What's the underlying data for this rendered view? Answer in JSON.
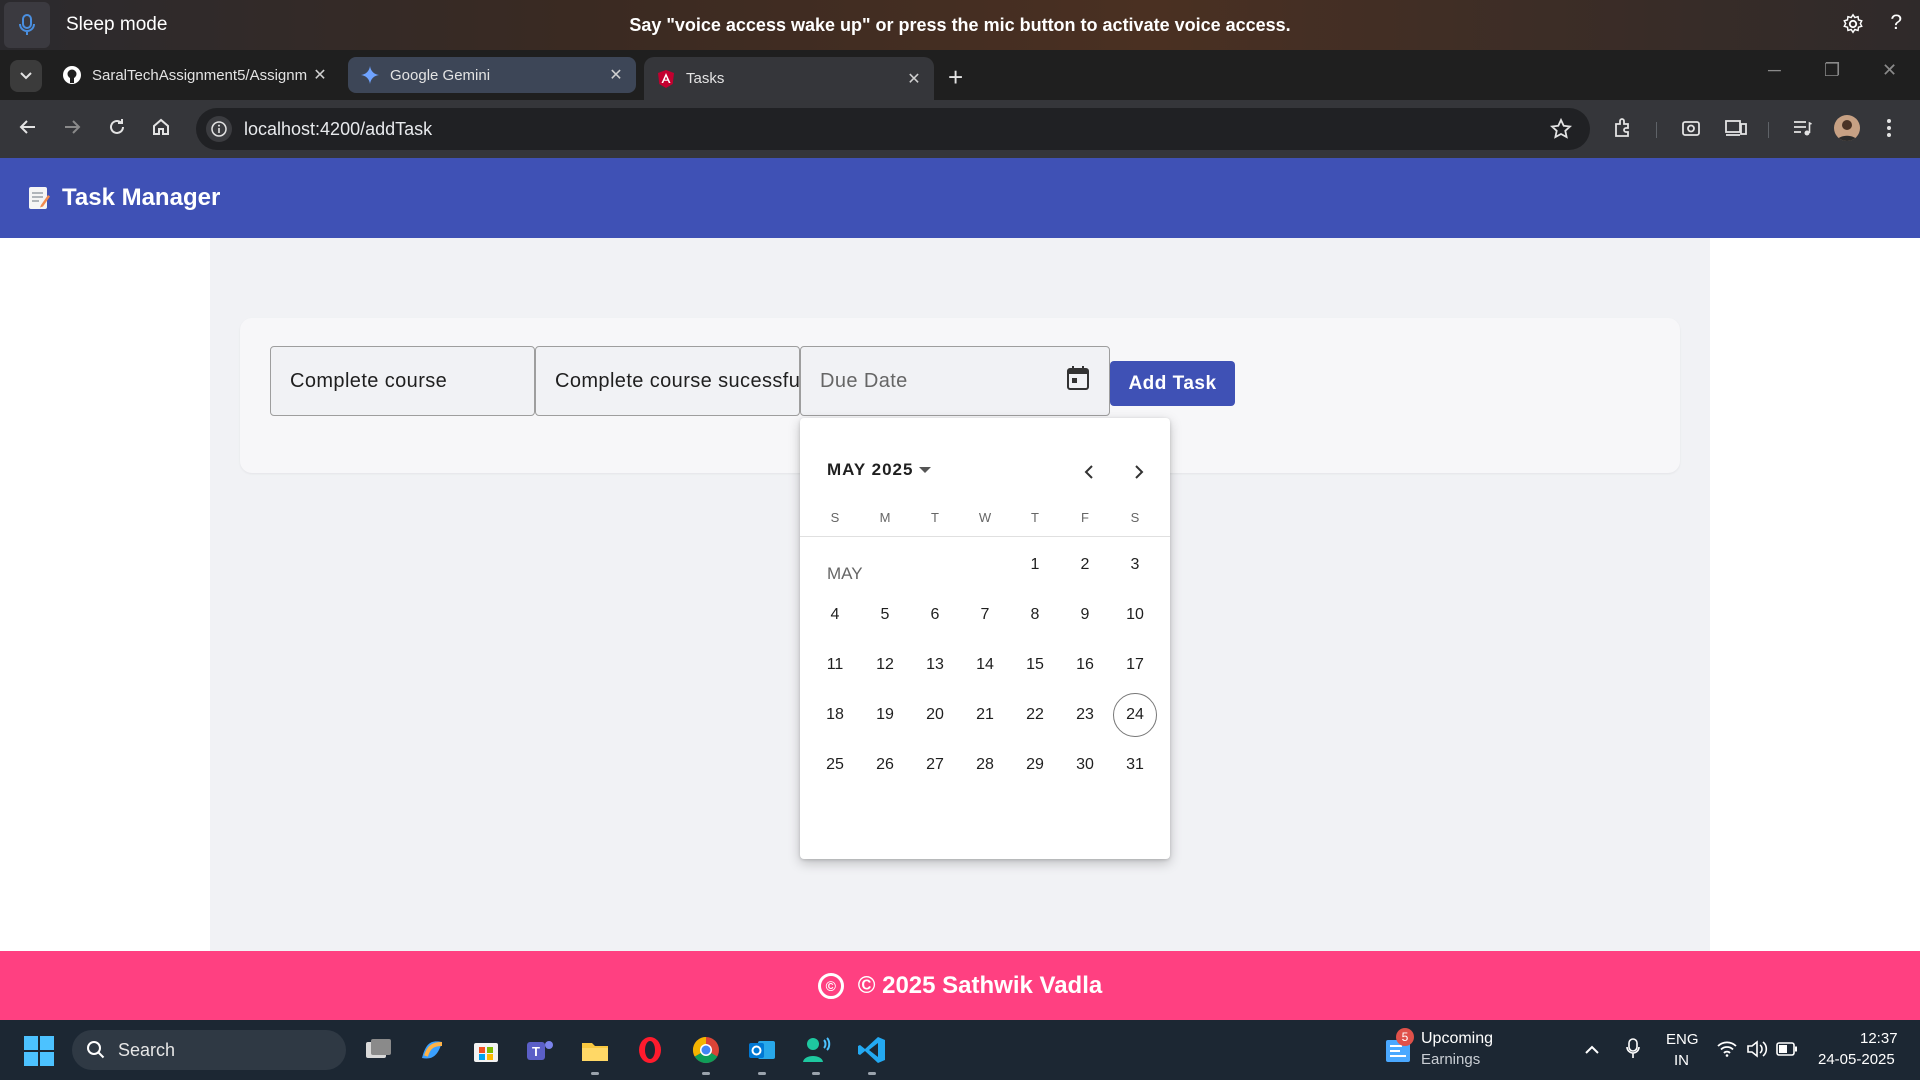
{
  "voice_access": {
    "mode": "Sleep mode",
    "message": "Say \"voice access wake up\" or press the mic button to activate voice access.",
    "help": "?"
  },
  "browser": {
    "tabs": [
      {
        "title": "SaralTechAssignment5/Assignm",
        "icon": "github-icon"
      },
      {
        "title": "Google Gemini",
        "icon": "gemini-icon"
      },
      {
        "title": "Tasks",
        "icon": "angular-icon",
        "active": true
      }
    ],
    "close_glyph": "✕",
    "new_tab_glyph": "+",
    "url": "localhost:4200/addTask"
  },
  "app": {
    "title": "Task Manager",
    "form": {
      "title_value": "Complete course",
      "description_value": "Complete course sucessfully",
      "due_date_placeholder": "Due Date",
      "add_button": "Add Task"
    },
    "calendar": {
      "period_label": "MAY 2025",
      "weekdays": [
        "S",
        "M",
        "T",
        "W",
        "T",
        "F",
        "S"
      ],
      "month_label": "MAY",
      "first_weekday_index": 4,
      "days_in_month": 31,
      "today": 24
    },
    "footer": "© 2025 Sathwik Vadla",
    "footer_icon": "©"
  },
  "taskbar": {
    "search_label": "Search",
    "apps": [
      "task-view-icon",
      "copilot-icon",
      "store-icon",
      "teams-icon",
      "file-explorer-icon",
      "opera-icon",
      "chrome-icon",
      "outlook-icon",
      "people-icon",
      "vscode-icon"
    ],
    "widget_badge": "5",
    "widget_title": "Upcoming",
    "widget_subtitle": "Earnings",
    "lang_top": "ENG",
    "lang_bottom": "IN",
    "time": "12:37",
    "date": "24-05-2025"
  },
  "colors": {
    "app_header": "#3f51b5",
    "footer": "#ff4081",
    "primary_button": "#3f51b5"
  }
}
